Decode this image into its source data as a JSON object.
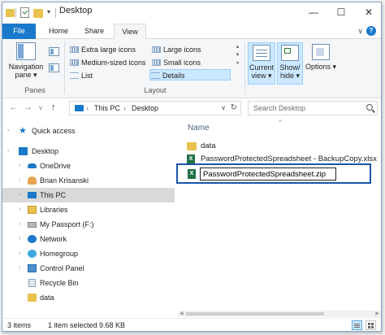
{
  "window": {
    "title": "Desktop",
    "minimize_glyph": "—",
    "maximize_glyph": "☐",
    "close_glyph": "✕"
  },
  "qat": {
    "dropdown_glyph": "▾"
  },
  "tabs": {
    "file": "File",
    "home": "Home",
    "share": "Share",
    "view": "View",
    "collapse_glyph": "∨",
    "help_glyph": "?"
  },
  "ribbon": {
    "panes": {
      "nav_pane_label": "Navigation pane ▾",
      "group_label": "Panes"
    },
    "layout": {
      "group_label": "Layout",
      "items": [
        {
          "label": "Extra large icons"
        },
        {
          "label": "Large icons"
        },
        {
          "label": "Medium-sized icons"
        },
        {
          "label": "Small icons"
        },
        {
          "label": "List"
        },
        {
          "label": "Details"
        }
      ],
      "scroll_up": "▲",
      "scroll_down": "▼",
      "scroll_more": "▾"
    },
    "current_view": {
      "label": "Current view ▾"
    },
    "show_hide": {
      "label": "Show/ hide ▾"
    },
    "options": {
      "label": "Options ▾"
    }
  },
  "address": {
    "back_glyph": "←",
    "forward_glyph": "→",
    "recent_glyph": "∨",
    "up_glyph": "↑",
    "sep_glyph": "›",
    "crumbs": [
      "This PC",
      "Desktop"
    ],
    "dropdown_glyph": "∨",
    "refresh_glyph": "↻",
    "search_placeholder": "Search Desktop"
  },
  "navtree": {
    "quick_access": "Quick access",
    "desktop": "Desktop",
    "onedrive": "OneDrive",
    "user": "Brian Krisanski",
    "this_pc": "This PC",
    "libraries": "Libraries",
    "passport": "My Passport (F:)",
    "network": "Network",
    "homegroup": "Homegroup",
    "control_panel": "Control Panel",
    "recycle_bin": "Recycle Bin",
    "data": "data",
    "chevron_glyph": "›",
    "star_glyph": "★"
  },
  "content": {
    "column_name": "Name",
    "sort_glyph": "^",
    "files": [
      {
        "name": "data",
        "type": "folder"
      },
      {
        "name": "PasswordProtectedSpreadsheet - BackupCopy.xlsx",
        "type": "xlsx"
      }
    ],
    "renaming_value": "PasswordProtectedSpreadsheet.zip",
    "xls_badge": "X"
  },
  "scrollbar": {
    "left_glyph": "◀",
    "right_glyph": "▶"
  },
  "status": {
    "items": "3 items",
    "selection": "1 item selected  9.68 KB"
  }
}
